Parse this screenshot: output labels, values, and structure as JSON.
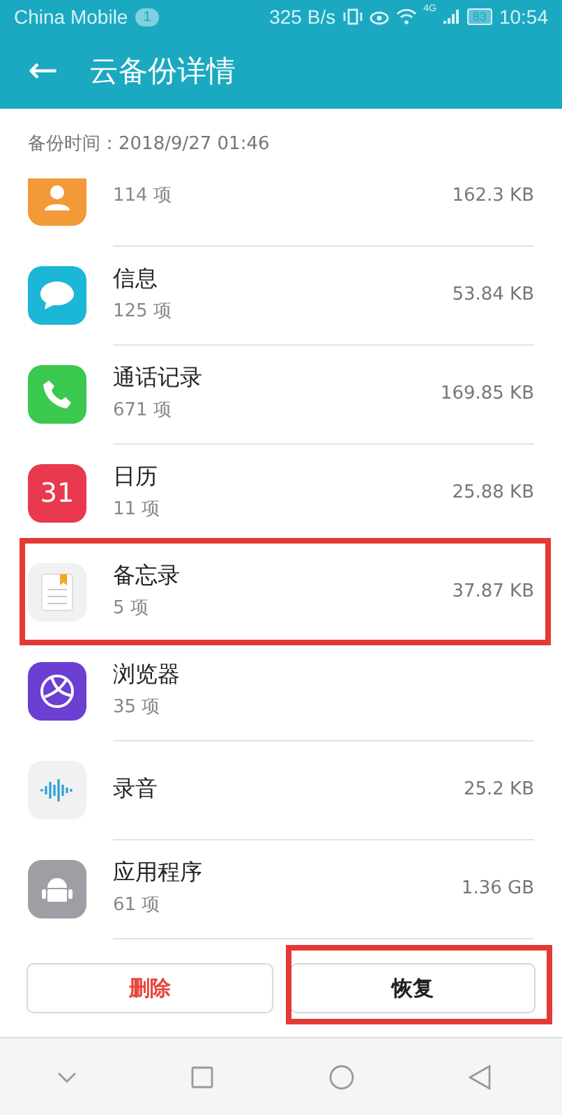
{
  "status_bar": {
    "carrier": "China Mobile",
    "notification_count": "1",
    "speed": "325 B/s",
    "network": "4G",
    "battery": "83",
    "time": "10:54"
  },
  "app_bar": {
    "back": "←",
    "title": "云备份详情"
  },
  "backup_time": "备份时间：2018/9/27 01:46",
  "items": [
    {
      "kind": "contacts",
      "count": "114 项",
      "size": "162.3 KB",
      "highlighted": false
    },
    {
      "kind": "messages",
      "name": "信息",
      "count": "125 项",
      "size": "53.84 KB",
      "highlighted": false
    },
    {
      "kind": "phone",
      "name": "通话记录",
      "count": "671 项",
      "size": "169.85 KB",
      "highlighted": false
    },
    {
      "kind": "calendar",
      "icon_text": "31",
      "name": "日历",
      "count": "11 项",
      "size": "25.88 KB",
      "highlighted": false
    },
    {
      "kind": "notes",
      "name": "备忘录",
      "count": "5 项",
      "size": "37.87 KB",
      "highlighted": true
    },
    {
      "kind": "browser",
      "name": "浏览器",
      "count": "35 项",
      "highlighted": false
    },
    {
      "kind": "recorder",
      "name": "录音",
      "size": "25.2 KB",
      "highlighted": false
    },
    {
      "kind": "android",
      "name": "应用程序",
      "count": "61 项",
      "size": "1.36 GB",
      "highlighted": false
    }
  ],
  "buttons": [
    {
      "kind": "danger",
      "label": "删除",
      "highlighted": false
    },
    {
      "kind": "normal",
      "label": "恢复",
      "highlighted": true
    }
  ]
}
